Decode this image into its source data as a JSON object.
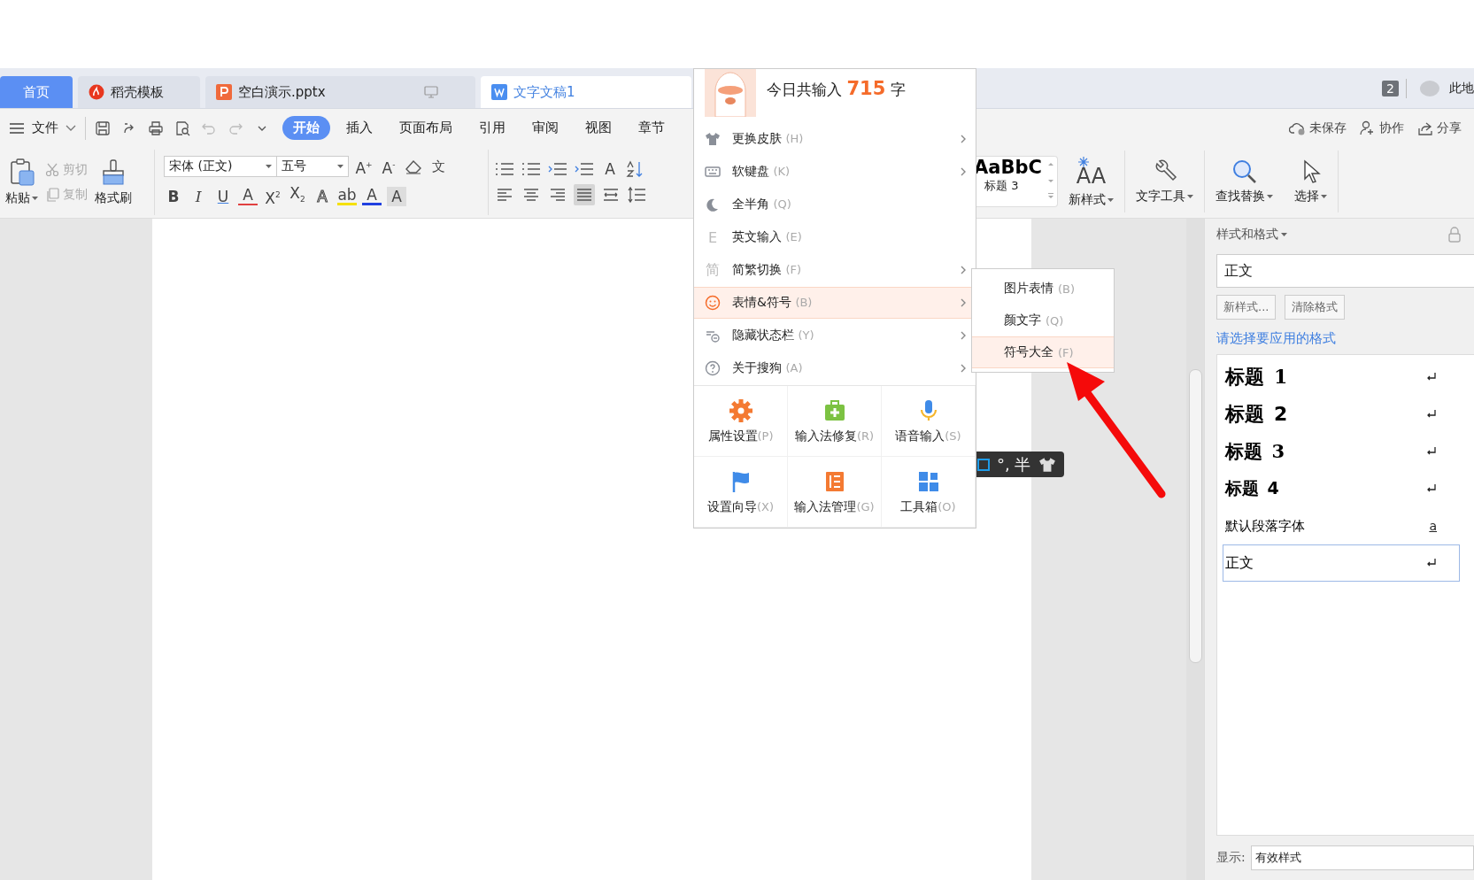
{
  "tabs": [
    {
      "label": "首页",
      "selected": false,
      "kind": "home"
    },
    {
      "label": "稻壳模板",
      "selected": false,
      "kind": "docer"
    },
    {
      "label": "空白演示.pptx",
      "selected": false,
      "kind": "pptx"
    },
    {
      "label": "文字文稿1",
      "selected": true,
      "kind": "doc"
    }
  ],
  "title_bar": {
    "badge": "2",
    "user": "此地"
  },
  "menu_bar": {
    "file": "文件",
    "tabs": [
      {
        "label": "开始",
        "selected": true
      },
      {
        "label": "插入",
        "selected": false
      },
      {
        "label": "页面布局",
        "selected": false
      },
      {
        "label": "引用",
        "selected": false
      },
      {
        "label": "审阅",
        "selected": false
      },
      {
        "label": "视图",
        "selected": false
      },
      {
        "label": "章节",
        "selected": false
      }
    ],
    "actions": [
      "未保存",
      "协作",
      "分享"
    ]
  },
  "ribbon": {
    "paste": "粘贴",
    "cut": "剪切",
    "copy": "复制",
    "format_painter": "格式刷",
    "font": "宋体 (正文)",
    "size": "五号",
    "font_tools": [
      "A$^{+}$",
      "A$^{-}$"
    ],
    "pinyin": "文",
    "format_glyphs": [
      "B",
      "I",
      "U",
      "A",
      "X$^{2}$",
      "X$_{2}$",
      "A",
      "ab",
      "A",
      "A"
    ],
    "direction_glyph": "A",
    "alignment": [
      {
        "selected": false
      },
      {
        "selected": false
      },
      {
        "selected": false
      },
      {
        "selected": true
      },
      {
        "selected": false
      }
    ],
    "style_preview": "AaBbC",
    "style_name": "标题 3",
    "new_style_glyph": "AA",
    "buttons": [
      "新样式",
      "文字工具",
      "查找替换",
      "选择"
    ]
  },
  "styles_panel": {
    "title": "样式和格式",
    "current": "正文",
    "buttons": [
      "新样式...",
      "清除格式"
    ],
    "prompt": "请选择要应用的格式",
    "styles": [
      {
        "name": "标题",
        "number": "1",
        "kind": "heading1",
        "selected": false
      },
      {
        "name": "标题",
        "number": "2",
        "kind": "heading2",
        "selected": false
      },
      {
        "name": "标题",
        "number": "3",
        "kind": "heading3",
        "selected": false
      },
      {
        "name": "标题",
        "number": "4",
        "kind": "heading4",
        "selected": false
      },
      {
        "name": "默认段落字体",
        "mark": "a",
        "kind": "character",
        "selected": false
      },
      {
        "name": "正文",
        "kind": "paragraph",
        "selected": true
      }
    ],
    "show_label": "显示:",
    "show_value": "有效样式"
  },
  "ime_menu": {
    "header": "今日共输入 **715** 字",
    "items": [
      {
        "label": "更换皮肤",
        "key": "(H)",
        "kind": "shirt",
        "submenu": true,
        "selected": false
      },
      {
        "label": "软键盘",
        "key": "(K)",
        "kind": "keyboard",
        "submenu": true,
        "selected": false
      },
      {
        "label": "全半角",
        "key": "(Q)",
        "kind": "moon",
        "submenu": false,
        "selected": false
      },
      {
        "label": "英文输入",
        "key": "(E)",
        "kind": "glyph",
        "glyph": "E",
        "submenu": false,
        "selected": false
      },
      {
        "label": "简繁切换",
        "key": "(F)",
        "kind": "glyph",
        "glyph": "简",
        "submenu": true,
        "selected": false
      },
      {
        "label": "表情&符号",
        "key": "(B)",
        "kind": "smile",
        "submenu": true,
        "selected": true
      },
      {
        "label": "隐藏状态栏",
        "key": "(Y)",
        "kind": "hide",
        "submenu": true,
        "selected": false
      },
      {
        "label": "关于搜狗",
        "key": "(A)",
        "kind": "help",
        "submenu": true,
        "selected": false
      }
    ],
    "tiles": [
      {
        "label": "属性设置",
        "key": "(P)",
        "kind": "gear"
      },
      {
        "label": "输入法修复",
        "key": "(R)",
        "kind": "medkit"
      },
      {
        "label": "语音输入",
        "key": "(S)",
        "kind": "mic"
      },
      {
        "label": "设置向导",
        "key": "(X)",
        "kind": "flag"
      },
      {
        "label": "输入法管理",
        "key": "(G)",
        "kind": "list"
      },
      {
        "label": "工具箱",
        "key": "(O)",
        "kind": "grid"
      }
    ]
  },
  "submenu": {
    "items": [
      {
        "label": "图片表情",
        "key": "(B)",
        "selected": false
      },
      {
        "label": "颜文字",
        "key": "(Q)",
        "selected": false
      },
      {
        "label": "符号大全",
        "key": "(F)",
        "selected": true
      }
    ]
  },
  "ime_status": {
    "text": "°, 半"
  }
}
